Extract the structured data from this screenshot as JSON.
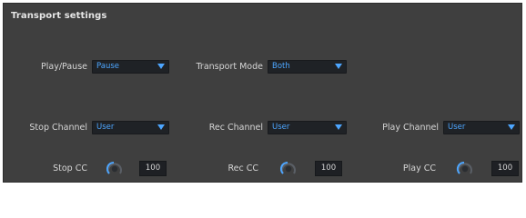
{
  "panel": {
    "title": "Transport settings"
  },
  "row1": {
    "play_pause": {
      "label": "Play/Pause",
      "value": "Pause"
    },
    "transport_mode": {
      "label": "Transport Mode",
      "value": "Both"
    }
  },
  "row2": {
    "stop_channel": {
      "label": "Stop Channel",
      "value": "User"
    },
    "rec_channel": {
      "label": "Rec Channel",
      "value": "User"
    },
    "play_channel": {
      "label": "Play Channel",
      "value": "User"
    }
  },
  "row3": {
    "stop_cc": {
      "label": "Stop CC",
      "value": "100"
    },
    "rec_cc": {
      "label": "Rec CC",
      "value": "100"
    },
    "play_cc": {
      "label": "Play CC",
      "value": "100"
    }
  },
  "colors": {
    "accent": "#4da6ff",
    "panel": "#3f3f3f",
    "field": "#1f2226"
  }
}
